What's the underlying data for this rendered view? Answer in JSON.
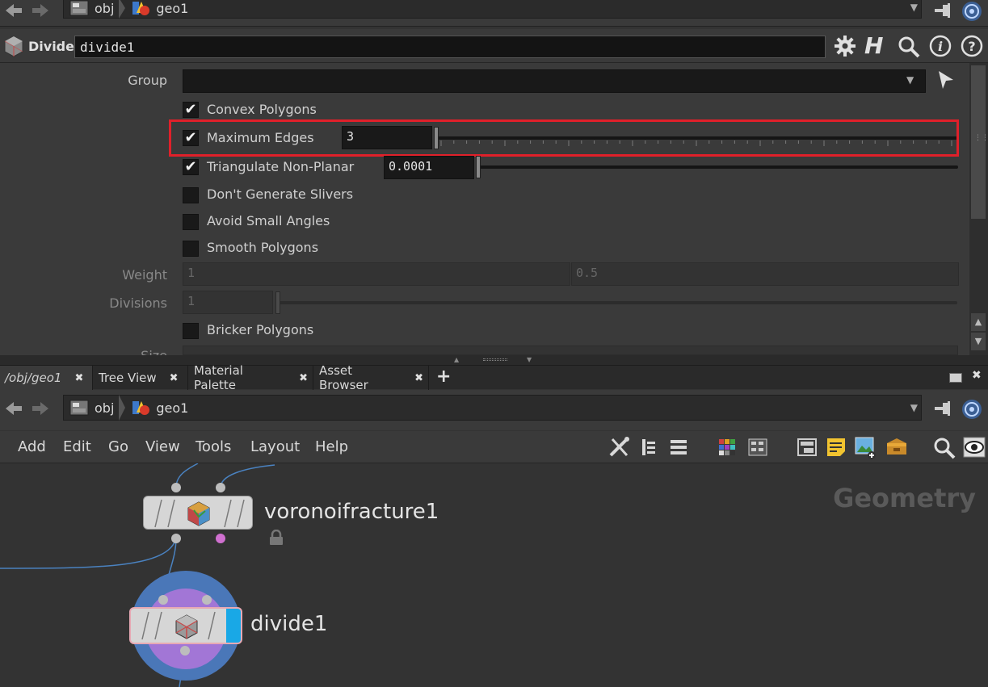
{
  "top_path": {
    "root": "obj",
    "current": "geo1"
  },
  "parm_header": {
    "op_type": "Divide",
    "node_name": "divide1"
  },
  "parms": {
    "group_label": "Group",
    "convex": {
      "label": "Convex Polygons",
      "checked": true
    },
    "max_edges": {
      "label": "Maximum Edges",
      "checked": true,
      "value": "3"
    },
    "triangulate": {
      "label": "Triangulate Non-Planar",
      "checked": true,
      "value": "0.0001"
    },
    "slivers": {
      "label": "Don't Generate Slivers",
      "checked": false
    },
    "small_angles": {
      "label": "Avoid Small Angles",
      "checked": false
    },
    "smooth": {
      "label": "Smooth Polygons",
      "checked": false
    },
    "weight": {
      "label": "Weight",
      "value1": "1",
      "value2": "0.5"
    },
    "divisions": {
      "label": "Divisions",
      "value": "1"
    },
    "bricker": {
      "label": "Bricker Polygons",
      "checked": false
    },
    "size_label": "Size"
  },
  "tabs": [
    {
      "label": "/obj/geo1"
    },
    {
      "label": "Tree View"
    },
    {
      "label": "Material Palette"
    },
    {
      "label": "Asset Browser"
    }
  ],
  "tab_add": "+",
  "net_path": {
    "root": "obj",
    "current": "geo1"
  },
  "menu": [
    "Add",
    "Edit",
    "Go",
    "View",
    "Tools",
    "Layout",
    "Help"
  ],
  "network": {
    "context_watermark": "Geometry",
    "nodes": [
      {
        "name": "voronoifracture1"
      },
      {
        "name": "divide1"
      }
    ]
  },
  "colors": {
    "highlight_box": "#e0202a",
    "selected_node_ring": "#4a77b8",
    "selected_node_inner": "#a276d6",
    "display_flag": "#19a8e6"
  }
}
